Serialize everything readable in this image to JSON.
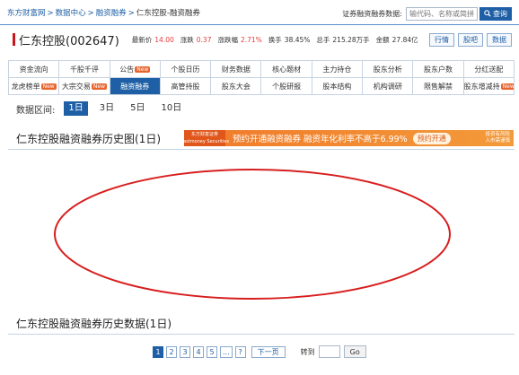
{
  "breadcrumb": {
    "items": [
      "东方财富网",
      "数据中心",
      "融资融券"
    ],
    "separator": ">",
    "current": "仁东控股-融资融券"
  },
  "search": {
    "label": "证券融资融券数据:",
    "placeholder": "输代码、名称或简拼",
    "button": "查询",
    "icon": "search-icon"
  },
  "stock": {
    "name": "仁东控股(002647)",
    "quote": [
      {
        "key": "最新价",
        "value": "14.00",
        "red": true
      },
      {
        "key": "涨跌",
        "value": "0.37",
        "red": true
      },
      {
        "key": "涨跌幅",
        "value": "2.71%",
        "red": true
      },
      {
        "key": "换手",
        "value": "38.45%",
        "red": false
      },
      {
        "key": "总手",
        "value": "215.28万手",
        "red": false
      },
      {
        "key": "金额",
        "value": "27.84亿",
        "red": false
      }
    ],
    "actions": [
      "行情",
      "股吧",
      "数据"
    ]
  },
  "nav": {
    "rows": [
      [
        {
          "label": "资金流向",
          "badge": ""
        },
        {
          "label": "千股千评",
          "badge": ""
        },
        {
          "label": "公告",
          "badge": "New"
        },
        {
          "label": "个股日历",
          "badge": ""
        },
        {
          "label": "财务数据",
          "badge": ""
        },
        {
          "label": "核心题材",
          "badge": ""
        },
        {
          "label": "主力持仓",
          "badge": ""
        },
        {
          "label": "股东分析",
          "badge": ""
        },
        {
          "label": "股东户数",
          "badge": ""
        },
        {
          "label": "分红送配",
          "badge": ""
        }
      ],
      [
        {
          "label": "龙虎榜单",
          "badge": "New"
        },
        {
          "label": "大宗交易",
          "badge": "New"
        },
        {
          "label": "融资融券",
          "badge": "",
          "active": true
        },
        {
          "label": "高管持股",
          "badge": ""
        },
        {
          "label": "股东大会",
          "badge": ""
        },
        {
          "label": "个股研报",
          "badge": ""
        },
        {
          "label": "股本结构",
          "badge": ""
        },
        {
          "label": "机构调研",
          "badge": ""
        },
        {
          "label": "限售解禁",
          "badge": ""
        },
        {
          "label": "股东增减持",
          "badge": "New"
        }
      ]
    ]
  },
  "range": {
    "label": "数据区间:",
    "options": [
      "1日",
      "3日",
      "5日",
      "10日"
    ],
    "selected": "1日"
  },
  "chart_section": {
    "title": "仁东控股融资融券历史图(1日)"
  },
  "ad": {
    "logo_line1": "东方财富证券",
    "logo_line2": "Eastmoney Securities",
    "text": "预约开通融资融券 融资年化利率不高于6.99%",
    "cta": "预约开通",
    "small_line1": "投资有风险",
    "small_line2": "入市需谨慎"
  },
  "table_section": {
    "title": "仁东控股融资融券历史数据(1日)"
  },
  "pager": {
    "pages": [
      "1",
      "2",
      "3",
      "4",
      "5",
      "...",
      "?"
    ],
    "current": "1",
    "next": "下一页",
    "goto_label": "转到",
    "go": "Go"
  },
  "colors": {
    "brand_blue": "#1f5fa6",
    "up_red": "#e43c3c",
    "badge_orange": "#e8632e",
    "ad_orange": "#f07a2a",
    "annotation_red": "#d81e1e"
  }
}
